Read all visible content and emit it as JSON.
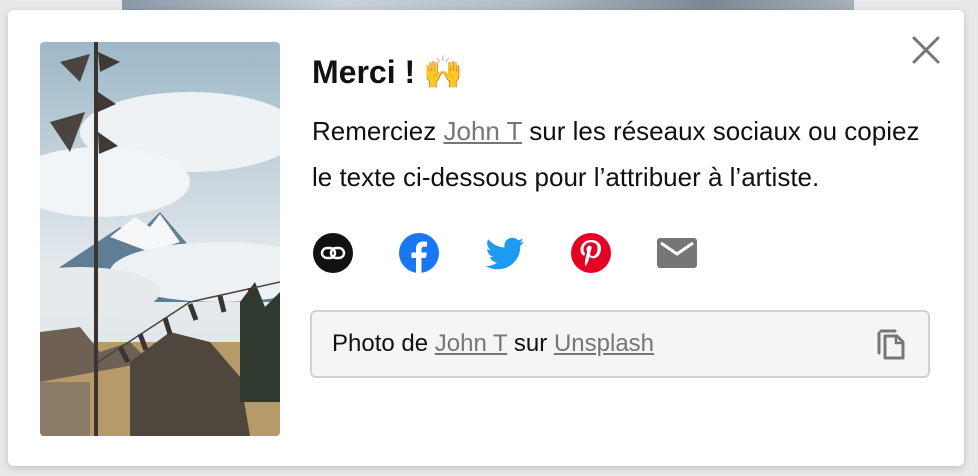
{
  "modal": {
    "title": "Merci !",
    "title_emoji": "🙌",
    "description": {
      "before": "Remerciez ",
      "author_link": "John T",
      "after": " sur les réseaux sociaux ou copiez le texte ci-dessous pour l’attribuer à l’artiste."
    },
    "share_buttons": [
      {
        "icon": "link-icon",
        "color": "#111111"
      },
      {
        "icon": "facebook-icon",
        "color": "#1877f2"
      },
      {
        "icon": "twitter-icon",
        "color": "#1d9bf0"
      },
      {
        "icon": "pinterest-icon",
        "color": "#e60023"
      },
      {
        "icon": "email-icon",
        "color": "#767676"
      }
    ],
    "attribution": {
      "prefix": "Photo de ",
      "author": "John T",
      "middle": " sur ",
      "site": "Unsplash"
    },
    "close_icon": "close-icon",
    "copy_icon": "copy-icon"
  }
}
